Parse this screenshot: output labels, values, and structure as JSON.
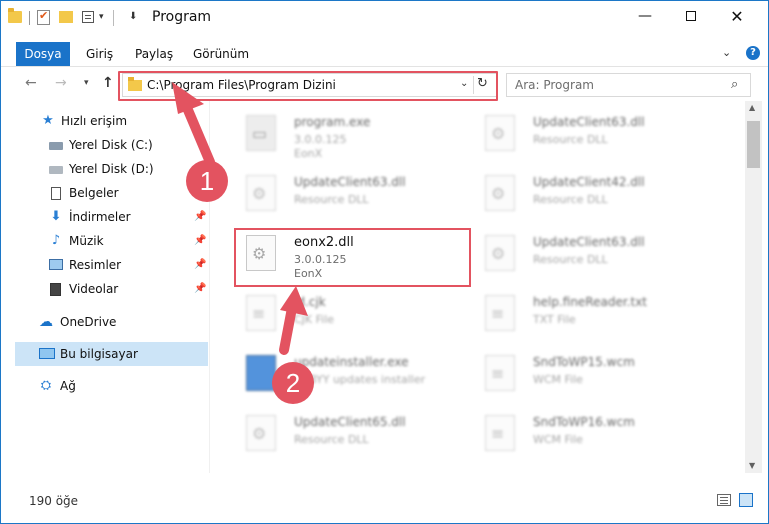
{
  "window": {
    "title": "Program",
    "min_glyph": "—",
    "close_glyph": "✕"
  },
  "ribbon": {
    "tabs": [
      "Dosya",
      "Giriş",
      "Paylaş",
      "Görünüm"
    ]
  },
  "address": {
    "path": "C:\\Program Files\\Program Dizini",
    "search_placeholder": "Ara: Program"
  },
  "sidebar": {
    "quick_access": "Hızlı erişim",
    "items": [
      {
        "label": "Yerel Disk (C:)",
        "icon": "drive-icon"
      },
      {
        "label": "Yerel Disk (D:)",
        "icon": "drive-icon"
      },
      {
        "label": "Belgeler",
        "icon": "documents-icon"
      },
      {
        "label": "İndirmeler",
        "icon": "downloads-icon"
      },
      {
        "label": "Müzik",
        "icon": "music-icon"
      },
      {
        "label": "Resimler",
        "icon": "pictures-icon"
      },
      {
        "label": "Videolar",
        "icon": "videos-icon"
      }
    ],
    "onedrive": "OneDrive",
    "this_pc": "Bu bilgisayar",
    "network": "Ağ"
  },
  "files": [
    {
      "name": "program.exe",
      "sub1": "3.0.0.125",
      "sub2": "EonX"
    },
    {
      "name": "UpdateClient63.dll",
      "sub1": "Resource DLL"
    },
    {
      "name": "UpdateClient63.dll",
      "sub1": "Resource DLL"
    },
    {
      "name": "UpdateClient42.dll",
      "sub1": "Resource DLL"
    },
    {
      "name": "eonx2.dll",
      "sub1": "3.0.0.125",
      "sub2": "EonX"
    },
    {
      "name": "UpdateClient63.dll",
      "sub1": "Resource DLL"
    },
    {
      "name": "ld.cjk",
      "sub1": "CJK File"
    },
    {
      "name": "help.fineReader.txt",
      "sub1": "TXT File"
    },
    {
      "name": "updateinstaller.exe",
      "sub1": "ABBYY updates installer"
    },
    {
      "name": "SndToWP15.wcm",
      "sub1": "WCM File"
    },
    {
      "name": "UpdateClient65.dll",
      "sub1": "Resource DLL"
    },
    {
      "name": "SndToWP16.wcm",
      "sub1": "WCM File"
    }
  ],
  "status": {
    "count": "190 öğe"
  },
  "callouts": [
    "1",
    "2"
  ],
  "colors": {
    "accent": "#1a73c9",
    "highlight": "#e35360",
    "selection": "#cce4f7"
  }
}
